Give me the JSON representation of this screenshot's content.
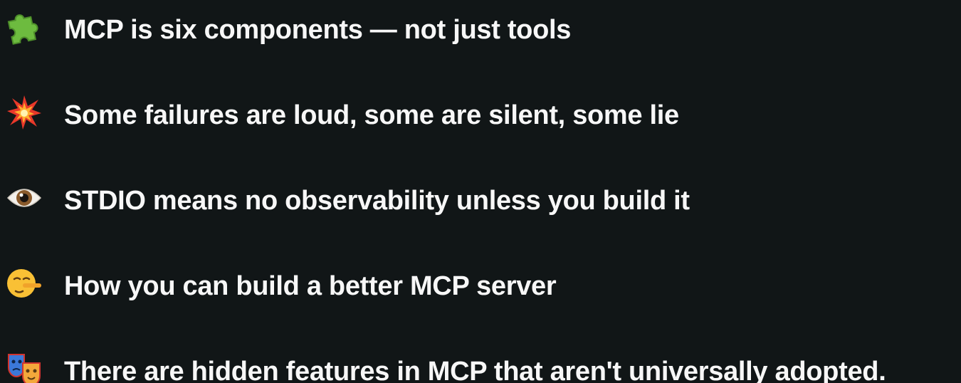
{
  "items": [
    {
      "icon": "puzzle-piece-icon",
      "text": "MCP is six components — not just tools"
    },
    {
      "icon": "collision-icon",
      "text": "Some failures are loud, some are silent, some lie"
    },
    {
      "icon": "eye-icon",
      "text": "STDIO means no observability unless you build it"
    },
    {
      "icon": "lying-face-icon",
      "text": "How you can build a better MCP server"
    },
    {
      "icon": "performing-arts-masks-icon",
      "text": "There are hidden features in MCP that aren't universally adopted."
    }
  ],
  "colors": {
    "background": "#111617",
    "text": "#f7f7f7"
  }
}
